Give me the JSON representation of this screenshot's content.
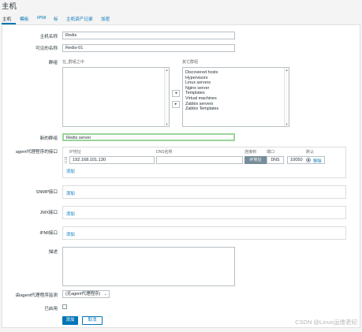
{
  "page": {
    "title": "主机"
  },
  "tabs": [
    {
      "label": "主机"
    },
    {
      "label": "模板"
    },
    {
      "label": "IPMI"
    },
    {
      "label": "标"
    },
    {
      "label": "主机资产记录"
    },
    {
      "label": "加密"
    }
  ],
  "form": {
    "hostname_label": "主机名称",
    "hostname_value": "Redis",
    "visible_name_label": "可见的名称",
    "visible_name_value": "Redis-01",
    "groups_label": "群组",
    "in_groups_label": "在_群组之中",
    "other_groups_label": "其它群组",
    "in_groups": [],
    "other_groups": [
      "Discovered hosts",
      "Hypervisors",
      "Linux servers",
      "Nginx server",
      "Templates",
      "Virtual machines",
      "Zabbix servers",
      "Zabbix Templates"
    ],
    "move_left": "◂",
    "move_right": "▸",
    "new_group_label": "新的群组",
    "new_group_value": "Redis server",
    "agent_iface_label": "agent代理程序的接口",
    "agent_cols": {
      "ip": "IP地址",
      "dns": "DNS名称",
      "connect": "连接到",
      "port": "端口",
      "default": "默认"
    },
    "agent_ip": "192.168.101.130",
    "agent_dns": "",
    "connect_ip": "IP地址",
    "connect_dns": "DNS",
    "agent_port": "10050",
    "remove_link": "移除",
    "add_link": "添加",
    "snmp_label": "SNMP接口",
    "jmx_label": "JMX接口",
    "ipmi_label": "IPMI接口",
    "description_label": "描述",
    "description_value": "",
    "proxy_label": "由agent代理程序监测",
    "proxy_value": "(无agent代理程序)",
    "enabled_label": "已启用",
    "add_button": "添加",
    "cancel_button": "取消"
  },
  "watermark": "CSDN @Linux运维老纪",
  "colors": {
    "accent": "#0275b8",
    "segment_on": "#768d99",
    "highlight_border": "#9bd49b"
  }
}
